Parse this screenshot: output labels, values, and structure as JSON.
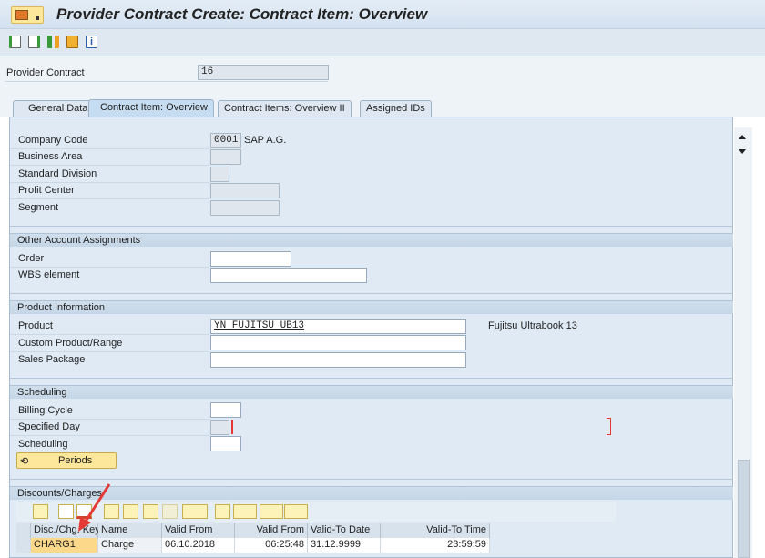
{
  "title": "Provider Contract Create: Contract Item: Overview",
  "toolbar": {
    "icons": [
      "new-document-icon",
      "forward-document-icon",
      "hierarchy-icon",
      "copy-icon",
      "info-icon"
    ]
  },
  "header": {
    "provider_contract_label": "Provider Contract",
    "provider_contract_value": "16"
  },
  "tabs": [
    {
      "label": "General Data"
    },
    {
      "label": "Contract Item: Overview",
      "active": true
    },
    {
      "label": "Contract Items: Overview II"
    },
    {
      "label": "Assigned IDs"
    }
  ],
  "org": {
    "company_code_label": "Company Code",
    "company_code_value": "0001",
    "company_name": "SAP A.G.",
    "business_area_label": "Business Area",
    "standard_division_label": "Standard Division",
    "profit_center_label": "Profit Center",
    "segment_label": "Segment"
  },
  "account": {
    "title": "Other Account Assignments",
    "order_label": "Order",
    "wbs_label": "WBS element"
  },
  "product": {
    "title": "Product Information",
    "product_label": "Product",
    "product_value": "YN FUJITSU UB13",
    "product_desc": "Fujitsu Ultrabook 13",
    "custom_label": "Custom Product/Range",
    "sales_package_label": "Sales Package"
  },
  "scheduling": {
    "title": "Scheduling",
    "billing_cycle_label": "Billing Cycle",
    "specified_day_label": "Specified Day",
    "scheduling_label": "Scheduling",
    "periods_label": "Periods"
  },
  "discounts": {
    "title": "Discounts/Charges",
    "columns": [
      "Disc./Chg. Key",
      "Name",
      "Valid From",
      "Valid From",
      "Valid-To Date",
      "Valid-To Time"
    ],
    "rows": [
      [
        "CHARG1",
        "Charge",
        "06.10.2018",
        "06:25:48",
        "31.12.9999",
        "23:59:59"
      ]
    ]
  },
  "colors": {
    "accent_yellow": "#fde79a",
    "panel": "#dfeaf5",
    "annotation_arrow": "#e53935"
  }
}
